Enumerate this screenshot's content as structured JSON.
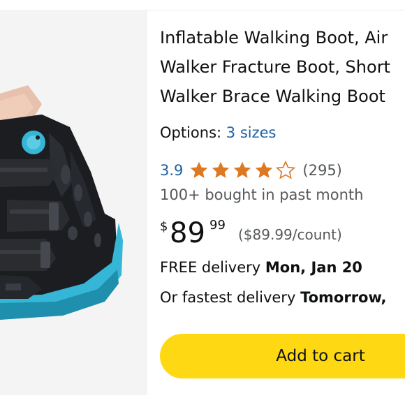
{
  "product": {
    "title_lines": [
      "Inflatable Walking Boot, Air",
      "Walker Fracture Boot, Short",
      "Walker Brace Walking Boot"
    ],
    "options_label": "Options:",
    "options_link": "3 sizes",
    "rating": "3.9",
    "rating_stars_fraction": 0.78,
    "review_count": "(295)",
    "bought": "100+ bought in past month",
    "price_symbol": "$",
    "price_whole": "89",
    "price_fraction": "99",
    "unit_price": "($89.99/count)",
    "delivery_prefix": "FREE delivery ",
    "delivery_date": "Mon, Jan 20",
    "fastest_prefix": "Or fastest delivery ",
    "fastest_date": "Tomorrow,",
    "image_alt": "walking-boot-photo"
  },
  "actions": {
    "add_to_cart_label": "Add to cart"
  },
  "colors": {
    "link": "#2162a1",
    "star": "#de7921",
    "cart_button": "#ffd814",
    "secondary_text": "#565959",
    "boot_black": "#1b1d20",
    "boot_accent": "#35b6d6"
  }
}
